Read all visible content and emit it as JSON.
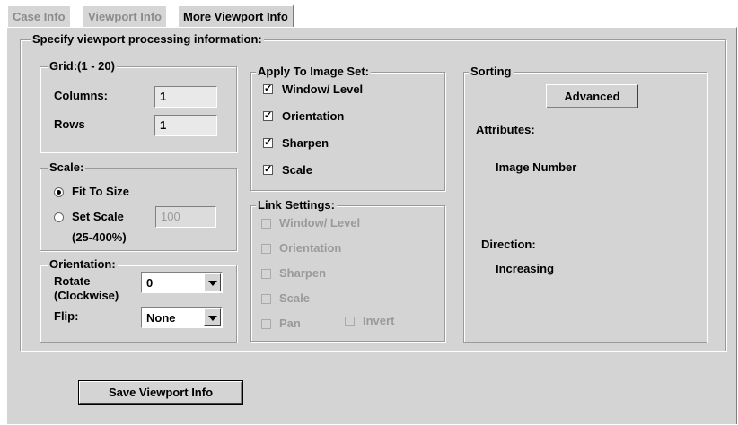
{
  "tabs": [
    {
      "label": "Case Info",
      "active": false
    },
    {
      "label": "Viewport Info",
      "active": false
    },
    {
      "label": "More Viewport Info",
      "active": true
    }
  ],
  "main_group": {
    "legend": "Specify viewport processing information:"
  },
  "grid": {
    "legend": "Grid:(1 - 20)",
    "columns_label": "Columns:",
    "columns_value": "1",
    "rows_label": "Rows",
    "rows_value": "1"
  },
  "scale": {
    "legend": "Scale:",
    "fit_label": "Fit To Size",
    "fit_selected": true,
    "set_label": "Set Scale",
    "set_value": "100",
    "range_label": "(25-400%)"
  },
  "orientation": {
    "legend": "Orientation:",
    "rotate_label_1": "Rotate",
    "rotate_label_2": "(Clockwise)",
    "rotate_value": "0",
    "flip_label": "Flip:",
    "flip_value": "None"
  },
  "apply": {
    "legend": "Apply To Image Set:",
    "items": [
      {
        "label": "Window/ Level",
        "checked": true
      },
      {
        "label": "Orientation",
        "checked": true
      },
      {
        "label": "Sharpen",
        "checked": true
      },
      {
        "label": "Scale",
        "checked": true
      }
    ]
  },
  "link": {
    "legend": "Link Settings:",
    "items": [
      {
        "label": "Window/ Level",
        "checked": false
      },
      {
        "label": "Orientation",
        "checked": false
      },
      {
        "label": "Sharpen",
        "checked": false
      },
      {
        "label": "Scale",
        "checked": false
      },
      {
        "label": "Pan",
        "checked": false
      },
      {
        "label": "Invert",
        "checked": false
      }
    ]
  },
  "sorting": {
    "legend": "Sorting",
    "advanced_label": "Advanced",
    "attributes_label": "Attributes:",
    "attribute_value": "Image Number",
    "direction_label": "Direction:",
    "direction_value": "Increasing"
  },
  "save_label": "Save Viewport Info"
}
